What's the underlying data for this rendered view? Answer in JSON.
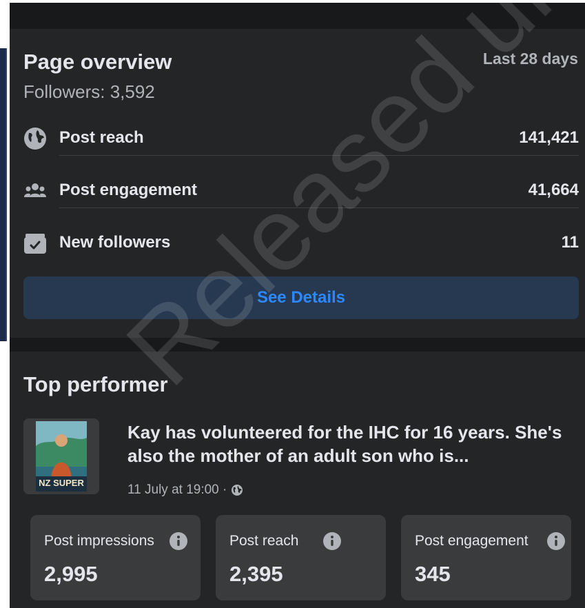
{
  "overview": {
    "title": "Page overview",
    "range_label": "Last 28 days",
    "followers": "Followers: 3,592",
    "metrics": [
      {
        "icon": "globe-icon",
        "label": "Post reach",
        "value": "141,421"
      },
      {
        "icon": "people-icon",
        "label": "Post engagement",
        "value": "41,664"
      },
      {
        "icon": "follow-check-icon",
        "label": "New followers",
        "value": "11"
      }
    ],
    "see_details_label": "See Details"
  },
  "top_performer": {
    "title": "Top performer",
    "thumbnail_text": "NZ SUPER",
    "post_text": "Kay has volunteered for the IHC for 16 years. She's also the mother of an adult son who is...",
    "post_meta": "11 July at 19:00 ·",
    "stats": [
      {
        "label": "Post impressions",
        "value": "2,995"
      },
      {
        "label": "Post reach",
        "value": "2,395"
      },
      {
        "label": "Post engagement",
        "value": "345"
      }
    ]
  },
  "watermark_text": "Released under",
  "colors": {
    "card_bg": "#242526",
    "page_bg": "#18191a",
    "button_bg": "#263951",
    "link_blue": "#2d88ff",
    "stat_bg": "#3a3b3c"
  }
}
